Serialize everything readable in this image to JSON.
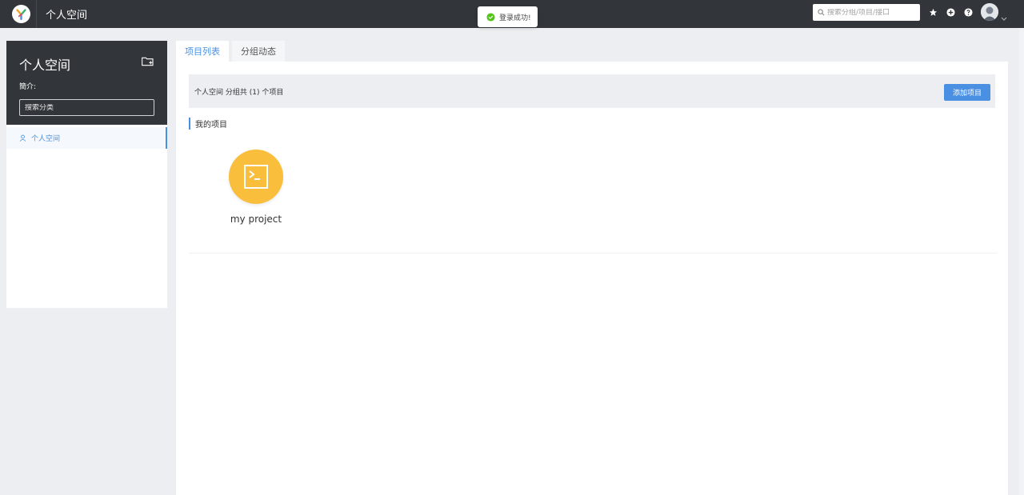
{
  "header": {
    "title": "个人空间",
    "search_placeholder": "搜索分组/项目/接口",
    "icons": [
      "star-icon",
      "plus-circle-icon",
      "help-icon"
    ]
  },
  "toast": {
    "message": "登录成功!",
    "status_color": "#52c41a"
  },
  "sidebar": {
    "title": "个人空间",
    "intro_label": "簡介:",
    "search_placeholder": "搜索分类",
    "items": [
      {
        "label": "个人空间",
        "icon": "user-icon",
        "active": true
      }
    ]
  },
  "tabs": [
    {
      "label": "项目列表",
      "active": true
    },
    {
      "label": "分组动态",
      "active": false
    }
  ],
  "main": {
    "info_text": "个人空间 分组共 (1) 个项目",
    "add_button": "添加项目",
    "section_title": "我的项目",
    "projects": [
      {
        "name": "my project",
        "color": "#f9be3c",
        "icon": "terminal-icon"
      }
    ]
  },
  "colors": {
    "accent": "#4a90e2",
    "header_bg": "#32363a"
  }
}
